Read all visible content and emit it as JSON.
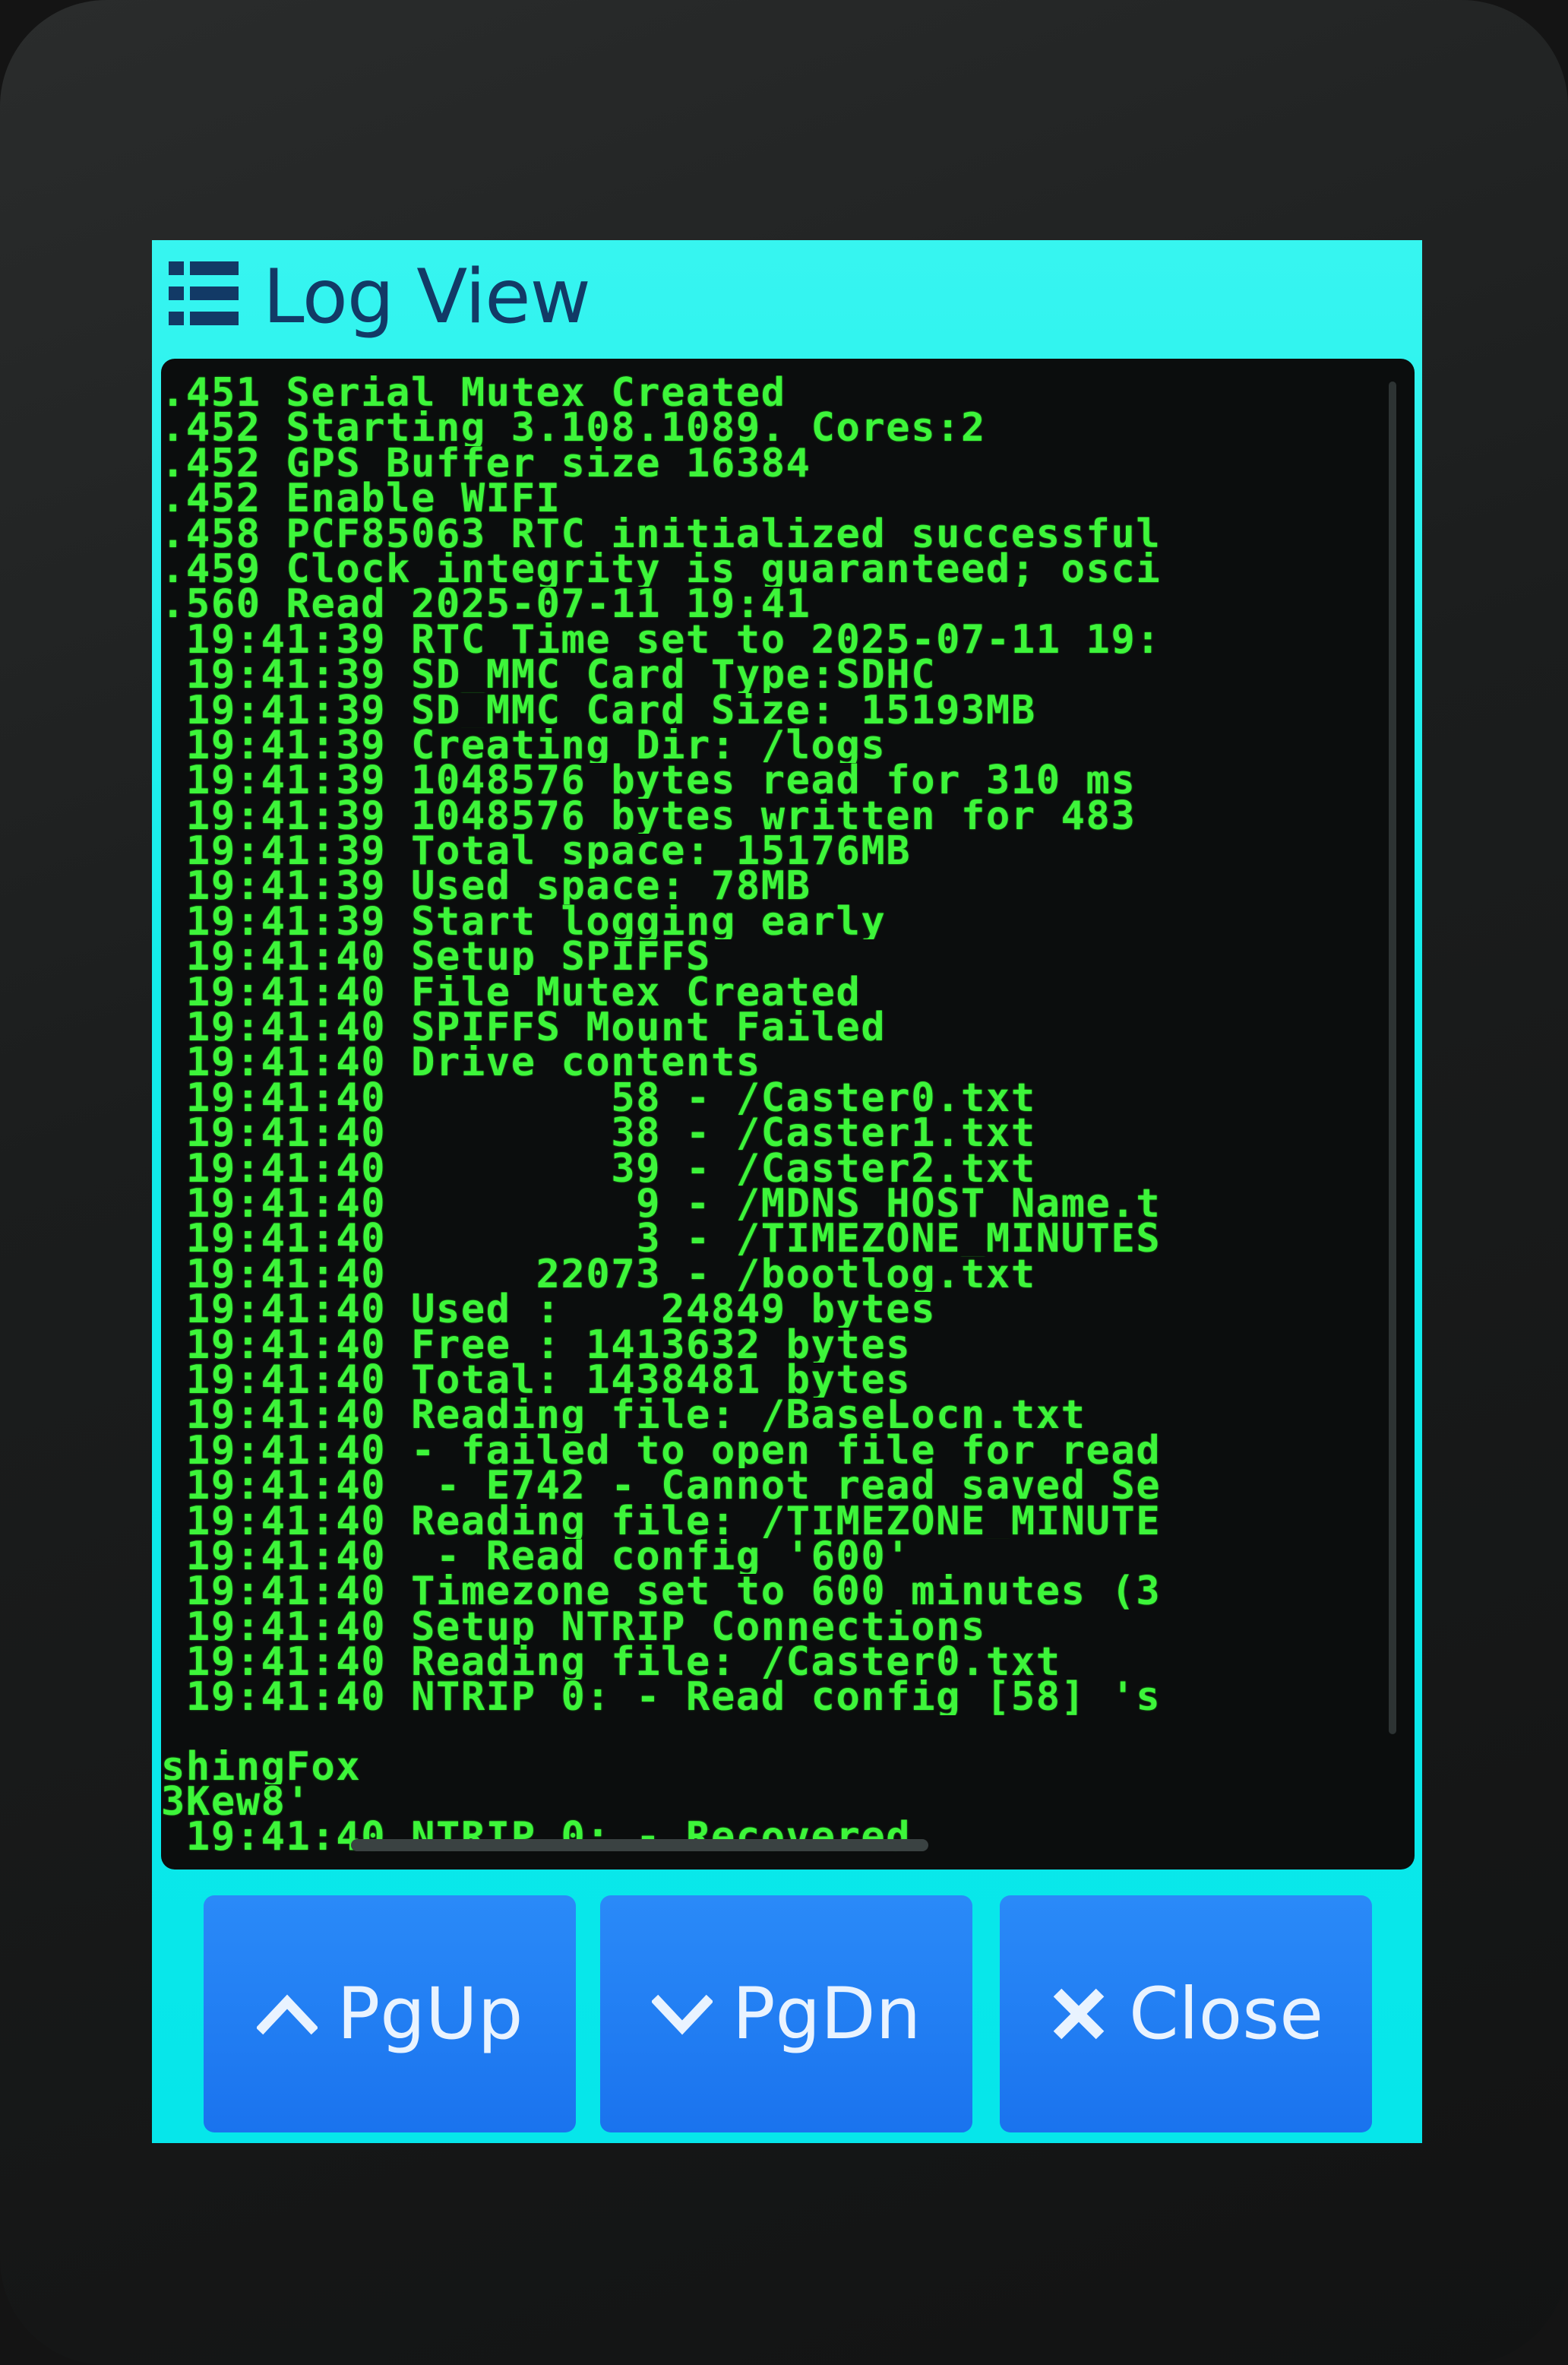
{
  "window": {
    "title": "Log View",
    "icon": "list-icon"
  },
  "log": {
    "lines": [
      ".451 Serial Mutex Created",
      ".452 Starting 3.108.1089. Cores:2",
      ".452 GPS Buffer size 16384",
      ".452 Enable WIFI",
      ".458 PCF85063 RTC initialized successful",
      ".459 Clock integrity is guaranteed; osci",
      ".560 Read 2025-07-11 19:41",
      " 19:41:39 RTC Time set to 2025-07-11 19:",
      " 19:41:39 SD_MMC Card Type:SDHC",
      " 19:41:39 SD_MMC Card Size: 15193MB",
      " 19:41:39 Creating Dir: /logs",
      " 19:41:39 1048576 bytes read for 310 ms",
      " 19:41:39 1048576 bytes written for 483",
      " 19:41:39 Total space: 15176MB",
      " 19:41:39 Used space: 78MB",
      " 19:41:39 Start logging early",
      " 19:41:40 Setup SPIFFS",
      " 19:41:40 File Mutex Created",
      " 19:41:40 SPIFFS Mount Failed",
      " 19:41:40 Drive contents",
      " 19:41:40         58 - /Caster0.txt",
      " 19:41:40         38 - /Caster1.txt",
      " 19:41:40         39 - /Caster2.txt",
      " 19:41:40          9 - /MDNS_HOST_Name.t",
      " 19:41:40          3 - /TIMEZONE_MINUTES",
      " 19:41:40      22073 - /bootlog.txt",
      " 19:41:40 Used :    24849 bytes",
      " 19:41:40 Free : 1413632 bytes",
      " 19:41:40 Total: 1438481 bytes",
      " 19:41:40 Reading file: /BaseLocn.txt",
      " 19:41:40 - failed to open file for read",
      " 19:41:40  - E742 - Cannot read saved Se",
      " 19:41:40 Reading file: /TIMEZONE_MINUTE",
      " 19:41:40  - Read config '600'",
      " 19:41:40 Timezone set to 600 minutes (3",
      " 19:41:40 Setup NTRIP Connections",
      " 19:41:40 Reading file: /Caster0.txt",
      " 19:41:40 NTRIP 0: - Read config [58] 's"
    ],
    "tail": [
      "shingFox",
      "3Kew8'",
      " 19:41:40 NTRIP 0: - Recovered"
    ]
  },
  "buttons": {
    "pgup": {
      "label": "PgUp",
      "icon": "chevron-up-icon"
    },
    "pgdn": {
      "label": "PgDn",
      "icon": "chevron-down-icon"
    },
    "close": {
      "label": "Close",
      "icon": "close-icon"
    }
  },
  "colors": {
    "title_bar": "#1aeeea",
    "log_text": "#3df53a",
    "log_background": "#0b0d0d",
    "button": "#1f7df2"
  }
}
